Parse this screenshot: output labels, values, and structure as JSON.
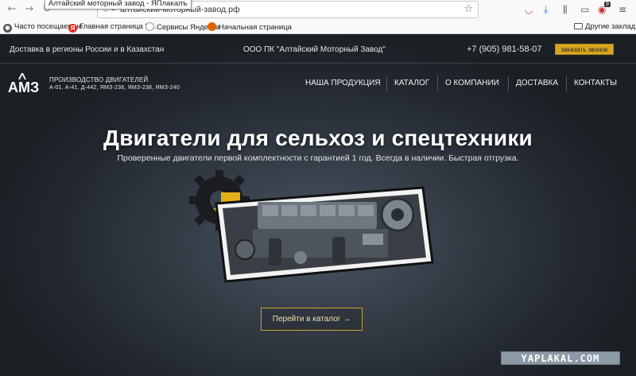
{
  "browser": {
    "tooltip": "Алтайский моторный завод - ЯПлакалъ",
    "url": "алтайский-моторный-завод.рф",
    "icons": [
      "back-icon",
      "forward-icon",
      "reload-icon",
      "star-icon",
      "pocket-icon",
      "download-icon",
      "library-icon",
      "reader-icon",
      "addon-icon",
      "menu-icon"
    ],
    "addon_badge": "9",
    "bookmarks": [
      "Часто посещаемые",
      "Главная страница Я...",
      "Сервисы Яндекса",
      "Начальная страница"
    ],
    "bookmarks_other": "Другие закладки"
  },
  "topbar": {
    "delivery": "Доставка в регионы России и в Казахстан",
    "company": "ООО ПК \"Алтайский Моторный Завод\"",
    "phone": "+7 (905) 981-58-07",
    "callback": "заказать звонок"
  },
  "logo": {
    "mark": "АМЗ",
    "line1": "ПРОИЗВОДСТВО ДВИГАТЕЛЕЙ",
    "line2": "А-01, А-41, Д-442, ЯМЗ-236, ЯМЗ-238, ЯМЗ-240"
  },
  "nav": [
    "НАША ПРОДУКЦИЯ",
    "КАТАЛОГ",
    "О КОМПАНИИ",
    "ДОСТАВКА",
    "КОНТАКТЫ"
  ],
  "hero": {
    "title": "Двигатели для сельхоз и спецтехники",
    "subtitle": "Проверенные двигатели первой комплектности с гарантией 1 год. Всегда в наличии. Быстрая отгрузка.",
    "cta": "Перейти в каталог →"
  },
  "watermark": "YAPLAKAL.COM",
  "colors": {
    "accent": "#d7a521",
    "page_bg": "#2a3039",
    "text": "#ffffff"
  }
}
